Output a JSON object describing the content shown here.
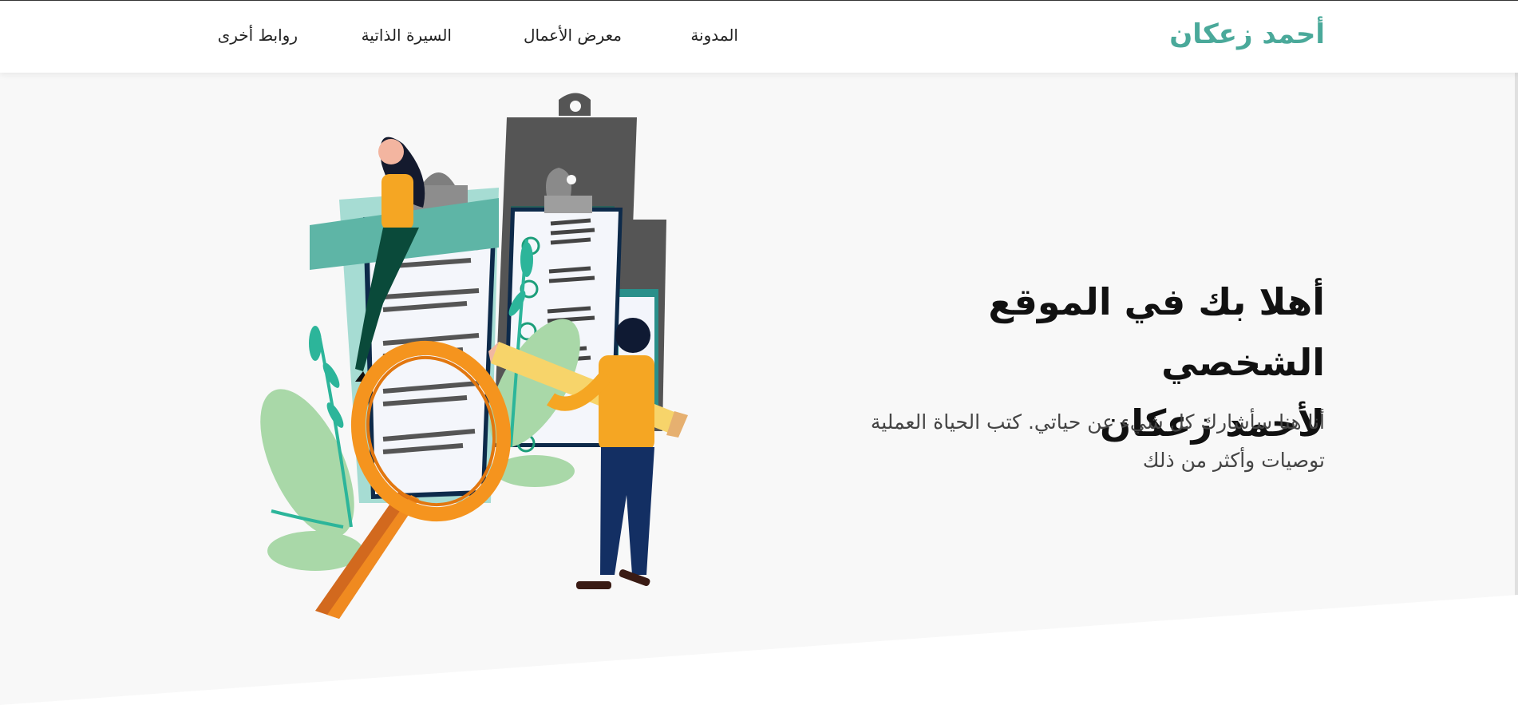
{
  "header": {
    "brand": "أحمد زعكان",
    "nav": [
      {
        "label": "المدونة"
      },
      {
        "label": "معرض الأعمال"
      },
      {
        "label": "السيرة الذاتية"
      },
      {
        "label": "روابط أخرى"
      }
    ]
  },
  "hero": {
    "title_line1": "أهلا بك في الموقع الشخصي",
    "title_line2": "لأحمد زعكان",
    "description": "أنا هنا سأشارك كل شيء عن حياتي. كتب الحياة العملية توصيات وأكثر من ذلك"
  },
  "colors": {
    "accent": "#4aa99a",
    "background": "#f8f8f8",
    "text": "#111111"
  }
}
